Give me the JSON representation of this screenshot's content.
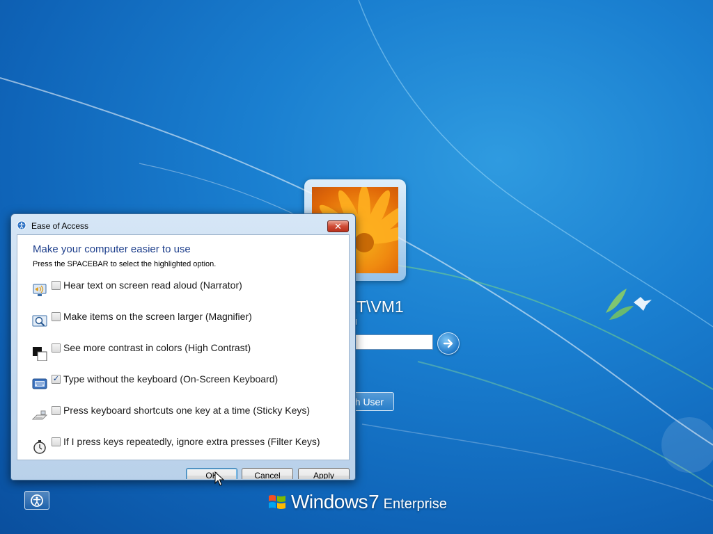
{
  "logon": {
    "username": "NET\\VM1",
    "status": "ked",
    "password_value": "",
    "switch_user_label": "h User"
  },
  "branding": {
    "name": "Windows",
    "version": "7",
    "edition": "Enterprise"
  },
  "dialog": {
    "title": "Ease of Access",
    "close_label": "✕",
    "heading": "Make your computer easier to use",
    "instruction": "Press the SPACEBAR to select the highlighted option.",
    "options": [
      {
        "label": "Hear text on screen read aloud (Narrator)",
        "checked": false,
        "icon": "narrator-icon"
      },
      {
        "label": "Make items on the screen larger (Magnifier)",
        "checked": false,
        "icon": "magnifier-icon"
      },
      {
        "label": "See more contrast in colors (High Contrast)",
        "checked": false,
        "icon": "high-contrast-icon"
      },
      {
        "label": "Type without the keyboard (On-Screen Keyboard)",
        "checked": true,
        "icon": "on-screen-keyboard-icon"
      },
      {
        "label": "Press keyboard shortcuts one key at a time (Sticky Keys)",
        "checked": false,
        "icon": "sticky-keys-icon"
      },
      {
        "label": "If I press keys repeatedly, ignore extra presses (Filter Keys)",
        "checked": false,
        "icon": "filter-keys-icon"
      }
    ],
    "buttons": {
      "ok": "OK",
      "cancel": "Cancel",
      "apply": "Apply"
    }
  },
  "colors": {
    "heading": "#1e3f8c",
    "close_button": "#cf4b35",
    "desktop_blue": "#1a7fd0"
  }
}
